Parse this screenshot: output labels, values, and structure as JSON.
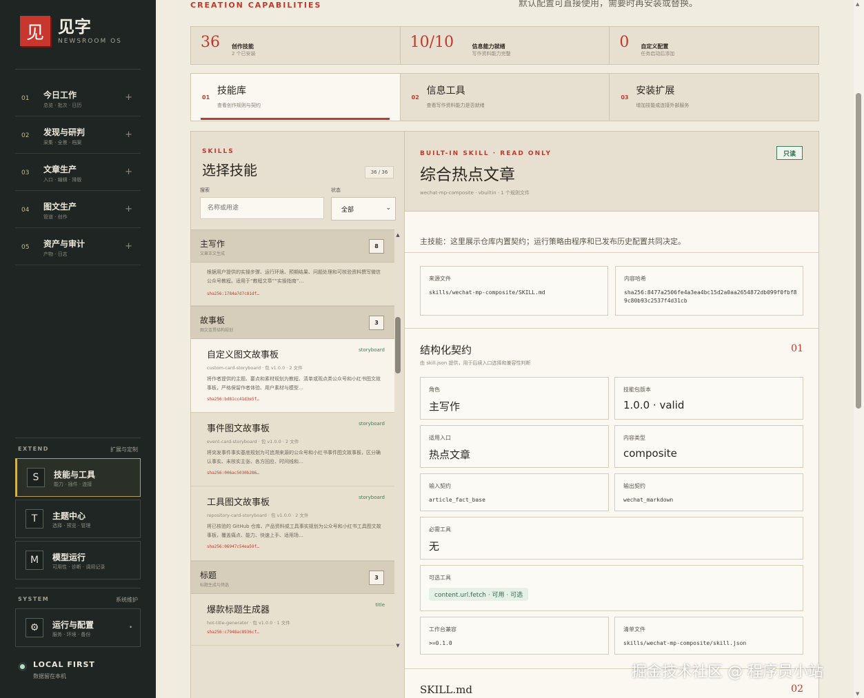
{
  "sidebar": {
    "logo_char": "见",
    "logo_title": "见字",
    "logo_sub": "NEWSROOM OS",
    "nav": [
      {
        "num": "01",
        "title": "今日工作",
        "sub": "总览 · 批次 · 日历"
      },
      {
        "num": "02",
        "title": "发现与研判",
        "sub": "采集 · 全景 · 档案"
      },
      {
        "num": "03",
        "title": "文章生产",
        "sub": "入口 · 编辑 · 排版"
      },
      {
        "num": "04",
        "title": "图文生产",
        "sub": "管道 · 创作"
      },
      {
        "num": "05",
        "title": "资产与审计",
        "sub": "产物 · 日志"
      }
    ],
    "extend_label": "EXTEND",
    "extend_label_cn": "扩展与定制",
    "extend": [
      {
        "icon": "S",
        "title": "技能与工具",
        "sub": "能力 · 插件 · 连接"
      },
      {
        "icon": "T",
        "title": "主题中心",
        "sub": "选择 · 预览 · 管理"
      },
      {
        "icon": "M",
        "title": "模型运行",
        "sub": "可用性 · 诊断 · 调用记录"
      }
    ],
    "system_label": "SYSTEM",
    "system_label_cn": "系统维护",
    "system": {
      "icon": "⚙",
      "title": "运行与配置",
      "sub": "服务 · 环境 · 备份",
      "dot": "•"
    },
    "local_title": "LOCAL FIRST",
    "local_sub": "数据留在本机"
  },
  "header": {
    "caps_label": "CREATION CAPABILITIES",
    "caps_hint": "默认配置可直接使用，需要时再安装或替换。"
  },
  "stats": [
    {
      "num": "36",
      "title": "创作技能",
      "sub": "2 个已安装"
    },
    {
      "num": "10/10",
      "title": "信息能力就绪",
      "sub": "写作资料能力完整"
    },
    {
      "num": "0",
      "title": "自定义配置",
      "sub": "任务启动后添加"
    }
  ],
  "tabs": [
    {
      "num": "01",
      "title": "技能库",
      "sub": "查看创作规则与契约"
    },
    {
      "num": "02",
      "title": "信息工具",
      "sub": "查看写作资料能力是否就绪"
    },
    {
      "num": "03",
      "title": "安装扩展",
      "sub": "增加技能或连接外部服务"
    }
  ],
  "skills": {
    "eyebrow": "SKILLS",
    "title": "选择技能",
    "count": "36 / 36",
    "search_label": "搜索",
    "search_placeholder": "名称或用途",
    "status_label": "状态",
    "status_value": "全部",
    "chevron": "⌄",
    "groups": [
      {
        "title": "主写作",
        "sub": "文章正文生成",
        "count": "8",
        "items": [
          {
            "title": "",
            "tag": "",
            "meta": "",
            "desc": "根据用户提供的实操步骤、运行环境、预期结果、问题处理和可核验资料撰写微信公众号教程。适用于“教程文章”“实操指南”…",
            "hash": "sha256:1784a7d7c81df…"
          }
        ]
      },
      {
        "title": "故事板",
        "sub": "图文连贯结构规划",
        "count": "3",
        "items": [
          {
            "title": "自定义图文故事板",
            "tag": "storyboard",
            "meta": "custom-card-storyboard · 包 v1.0.0 · 2 文件",
            "desc": "将作者提供的主题、要点和素材规划为教程、清单或观点类公众号和小红书图文故事板，严格保留作者体验、用户素材与模型…",
            "hash": "sha256:bd81cc41d3e5f…"
          },
          {
            "title": "事件图文故事板",
            "tag": "storyboard",
            "meta": "event-card-storyboard · 包 v1.0.0 · 2 文件",
            "desc": "将突发事件事实基底规划为可追溯来源的公众号和小红书事件图文故事板，区分确认事实、未核实主张、各方回应、时间线和…",
            "hash": "sha256:006ac5030b286…"
          },
          {
            "title": "工具图文故事板",
            "tag": "storyboard",
            "meta": "repository-card-storyboard · 包 v1.0.0 · 2 文件",
            "desc": "将已核验的 GitHub 仓库、产品资料或工具事实规划为公众号和小红书工具图文故事板，覆盖痛点、能力、快速上手、适用场…",
            "hash": "sha256:06947c54ea59f…"
          }
        ]
      },
      {
        "title": "标题",
        "sub": "标题生成与筛选",
        "count": "3",
        "items": [
          {
            "title": "爆款标题生成器",
            "tag": "title",
            "meta": "hot-title-generator · 包 v1.0.0 · 1 文件",
            "desc": "",
            "hash": "sha256:c7948ac8936cf…"
          }
        ]
      }
    ],
    "scroll_up": "▲",
    "scroll_down": "▼"
  },
  "detail": {
    "eyebrow": "BUILT-IN SKILL · READ ONLY",
    "title": "综合热点文章",
    "meta": "wechat-mp-composite · vbuiltin · 1 个规则文件",
    "badge": "只读",
    "note": "主技能：这里展示仓库内置契约；运行策略由程序和已发布历史配置共同决定。",
    "source_label": "来源文件",
    "source_value": "skills/wechat-mp-composite/SKILL.md",
    "hash_label": "内容哈希",
    "hash_value": "sha256:8477a2506fe4a3ea4bc15d2a0aa2654872db099f0fbf89c80b93c2537f4d31cb",
    "contract_title": "结构化契约",
    "contract_sub": "由 skill.json 提供，用于后续入口选择和兼容性判断",
    "contract_num": "01",
    "role_label": "角色",
    "role_value": "主写作",
    "version_label": "技能包版本",
    "version_value": "1.0.0 · valid",
    "entry_label": "适用入口",
    "entry_value": "热点文章",
    "ctype_label": "内容类型",
    "ctype_value": "composite",
    "input_label": "输入契约",
    "input_value": "article_fact_base",
    "output_label": "输出契约",
    "output_value": "wechat_markdown",
    "required_label": "必需工具",
    "required_value": "无",
    "optional_label": "可选工具",
    "optional_value": "content.url.fetch · 可用 · 可选",
    "compat_label": "工作台兼容",
    "compat_value": ">=0.1.0",
    "manifest_label": "清单文件",
    "manifest_value": "skills/wechat-mp-composite/skill.json",
    "skillmd_title": "SKILL.md",
    "skillmd_num": "02"
  },
  "page_scroll": {
    "up": "▲",
    "down": "▼"
  },
  "watermark": "掘金技术社区 @ 程序员小站"
}
